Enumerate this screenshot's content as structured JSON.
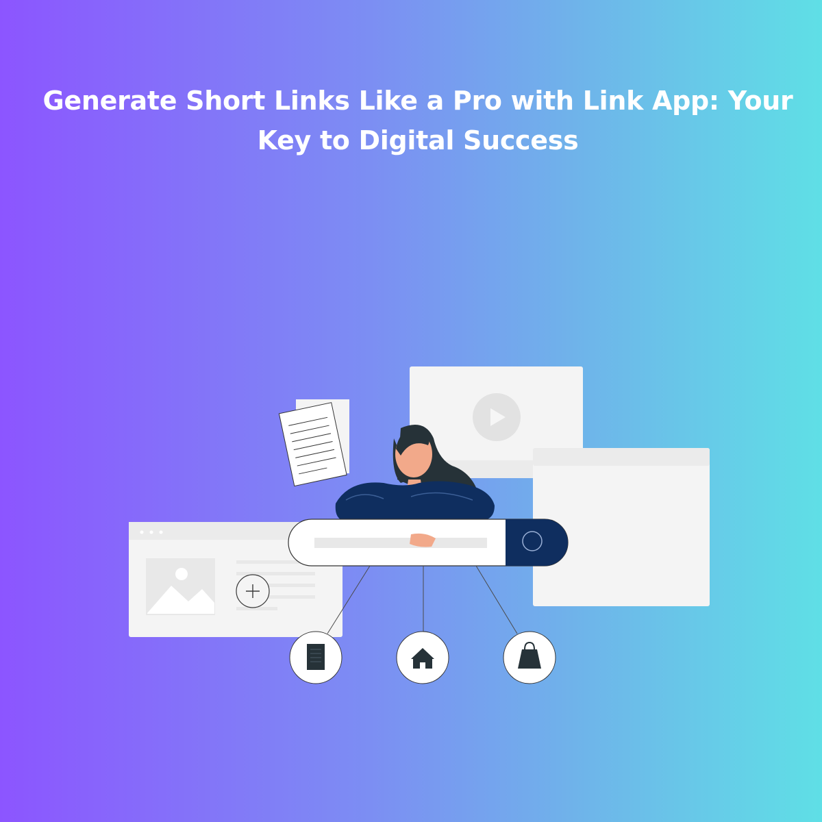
{
  "headline": "Generate Short Links Like a Pro with Link App: Your Key to Digital Success",
  "colors": {
    "gradient_start": "#8c55ff",
    "gradient_end": "#5fdfe6",
    "text": "#ffffff",
    "navy": "#0f2e5f",
    "card": "#f4f4f4"
  },
  "illustration": {
    "link_icons": [
      "document-icon",
      "home-icon",
      "shopping-bag-icon"
    ],
    "play_icon": "play-icon",
    "search_icon": "search-icon",
    "add_icon": "plus-icon",
    "image_icon": "image-placeholder-icon"
  }
}
